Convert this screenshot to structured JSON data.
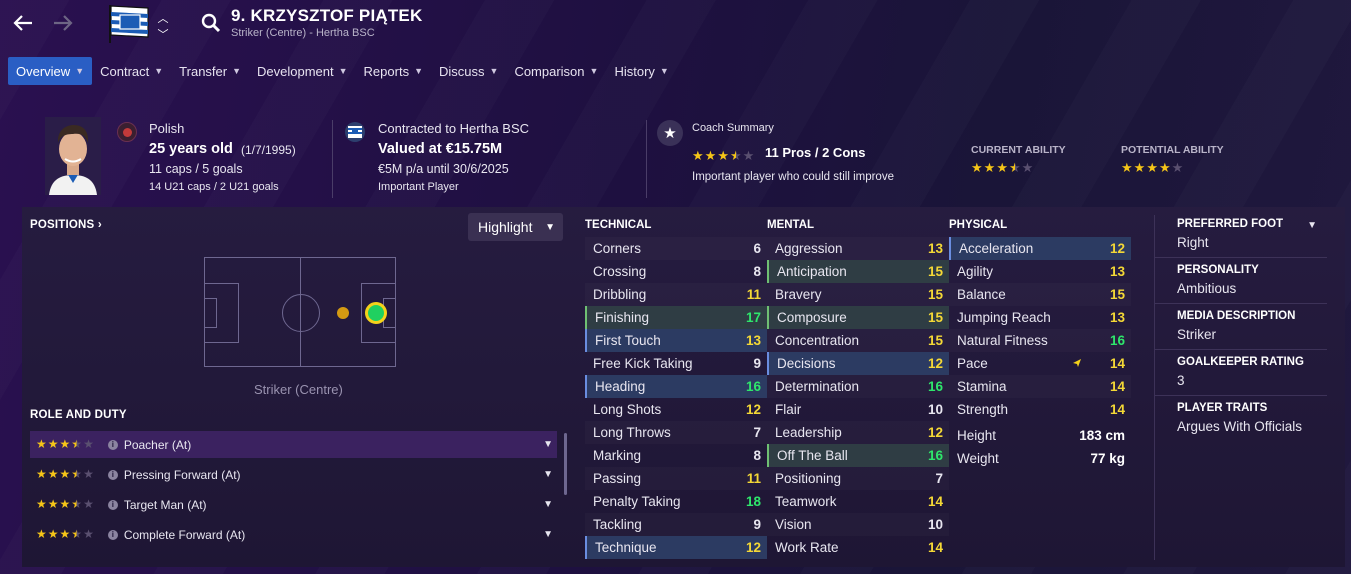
{
  "header": {
    "player_name": "9. KRZYSZTOF PIĄTEK",
    "player_sub": "Striker (Centre) - Hertha BSC",
    "club_badge_text": "Hertha BSC"
  },
  "tabs": [
    {
      "label": "Overview",
      "active": true
    },
    {
      "label": "Contract"
    },
    {
      "label": "Transfer"
    },
    {
      "label": "Development"
    },
    {
      "label": "Reports"
    },
    {
      "label": "Discuss"
    },
    {
      "label": "Comparison"
    },
    {
      "label": "History"
    }
  ],
  "profile": {
    "nationality": "Polish",
    "age": "25 years old",
    "dob": "(1/7/1995)",
    "caps": "11 caps / 5 goals",
    "u21_caps": "14 U21 caps / 2 U21 goals"
  },
  "contract": {
    "title": "Contracted to Hertha BSC",
    "value": "Valued at €15.75M",
    "wage": "€5M p/a until 30/6/2025",
    "status": "Important Player"
  },
  "coach": {
    "title": "Coach Summary",
    "stars": 3.5,
    "pros_cons": "11 Pros / 2 Cons",
    "note": "Important player who could still improve"
  },
  "ability": {
    "current_label": "CURRENT ABILITY",
    "current_stars": 3.5,
    "potential_label": "POTENTIAL ABILITY",
    "potential_stars": 4
  },
  "positions": {
    "heading": "POSITIONS",
    "highlight_label": "Highlight",
    "position_label": "Striker (Centre)"
  },
  "roles": {
    "heading": "ROLE AND DUTY",
    "items": [
      {
        "name": "Poacher (At)",
        "stars": 3.5
      },
      {
        "name": "Pressing Forward (At)",
        "stars": 3.5
      },
      {
        "name": "Target Man (At)",
        "stars": 3.5
      },
      {
        "name": "Complete Forward (At)",
        "stars": 3.5
      }
    ]
  },
  "technical": {
    "heading": "TECHNICAL",
    "items": [
      {
        "name": "Corners",
        "value": "6"
      },
      {
        "name": "Crossing",
        "value": "8"
      },
      {
        "name": "Dribbling",
        "value": "11"
      },
      {
        "name": "Finishing",
        "value": "17"
      },
      {
        "name": "First Touch",
        "value": "13"
      },
      {
        "name": "Free Kick Taking",
        "value": "9"
      },
      {
        "name": "Heading",
        "value": "16"
      },
      {
        "name": "Long Shots",
        "value": "12"
      },
      {
        "name": "Long Throws",
        "value": "7"
      },
      {
        "name": "Marking",
        "value": "8"
      },
      {
        "name": "Passing",
        "value": "11"
      },
      {
        "name": "Penalty Taking",
        "value": "18"
      },
      {
        "name": "Tackling",
        "value": "9"
      },
      {
        "name": "Technique",
        "value": "12"
      }
    ]
  },
  "mental": {
    "heading": "MENTAL",
    "items": [
      {
        "name": "Aggression",
        "value": "13"
      },
      {
        "name": "Anticipation",
        "value": "15"
      },
      {
        "name": "Bravery",
        "value": "15"
      },
      {
        "name": "Composure",
        "value": "15"
      },
      {
        "name": "Concentration",
        "value": "15"
      },
      {
        "name": "Decisions",
        "value": "12"
      },
      {
        "name": "Determination",
        "value": "16"
      },
      {
        "name": "Flair",
        "value": "10"
      },
      {
        "name": "Leadership",
        "value": "12"
      },
      {
        "name": "Off The Ball",
        "value": "16"
      },
      {
        "name": "Positioning",
        "value": "7"
      },
      {
        "name": "Teamwork",
        "value": "14"
      },
      {
        "name": "Vision",
        "value": "10"
      },
      {
        "name": "Work Rate",
        "value": "14"
      }
    ]
  },
  "physical": {
    "heading": "PHYSICAL",
    "items": [
      {
        "name": "Acceleration",
        "value": "12"
      },
      {
        "name": "Agility",
        "value": "13"
      },
      {
        "name": "Balance",
        "value": "15"
      },
      {
        "name": "Jumping Reach",
        "value": "13"
      },
      {
        "name": "Natural Fitness",
        "value": "16"
      },
      {
        "name": "Pace",
        "value": "14"
      },
      {
        "name": "Stamina",
        "value": "14"
      },
      {
        "name": "Strength",
        "value": "14"
      }
    ],
    "height_label": "Height",
    "height": "183 cm",
    "weight_label": "Weight",
    "weight": "77 kg"
  },
  "side": {
    "foot_label": "PREFERRED FOOT",
    "foot": "Right",
    "personality_label": "PERSONALITY",
    "personality": "Ambitious",
    "media_label": "MEDIA DESCRIPTION",
    "media": "Striker",
    "gk_label": "GOALKEEPER RATING",
    "gk": "3",
    "traits_label": "PLAYER TRAITS",
    "traits": "Argues With Officials"
  },
  "colors": {
    "accent": "#2a5ec4",
    "star": "#f5c518",
    "value_yellow": "#f4d836",
    "value_green": "#2ee66b"
  }
}
